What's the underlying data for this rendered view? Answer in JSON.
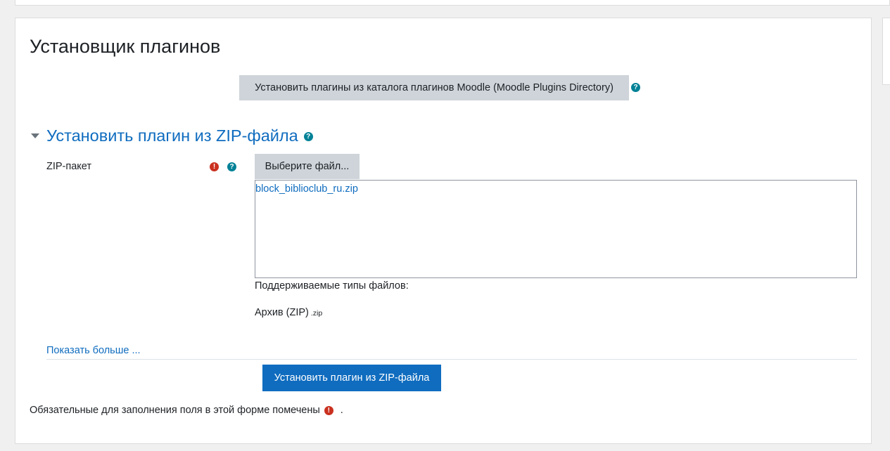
{
  "page": {
    "title": "Установщик плагинов"
  },
  "directory_button": {
    "label": "Установить плагины из каталога плагинов Moodle (Moodle Plugins Directory)"
  },
  "section": {
    "title": "Установить плагин из ZIP-файла",
    "expanded": true
  },
  "zip_field": {
    "label": "ZIP-пакет",
    "choose_button": "Выберите файл...",
    "selected_file": "block_biblioclub_ru.zip",
    "supported_types_label": "Поддерживаемые типы файлов:",
    "type_name": "Архив (ZIP)",
    "type_ext": ".zip"
  },
  "show_more": "Показать больше ...",
  "install_button": "Установить плагин из ZIP-файла",
  "required_note": {
    "text": "Обязательные для заполнения поля в этой форме помечены",
    "suffix": "."
  },
  "icons": {
    "help": "question-circle-icon",
    "required": "exclamation-circle-icon",
    "caret": "caret-down-icon"
  },
  "colors": {
    "link": "#0f6cbf",
    "primary": "#0f6cbf",
    "help_icon": "#008196",
    "required_icon": "#ca3120",
    "secondary_button": "#ced4da"
  }
}
